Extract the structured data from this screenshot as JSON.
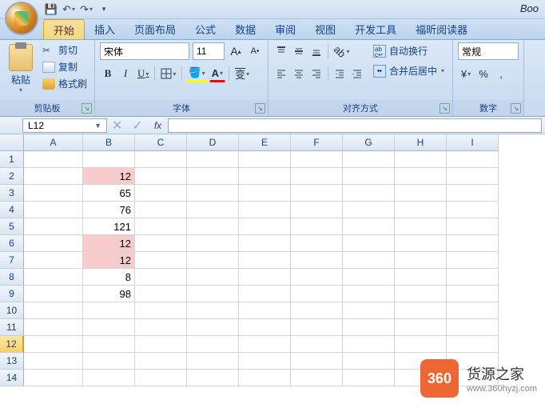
{
  "title": "Boo",
  "qat": {
    "save": "save-icon",
    "undo": "undo-icon",
    "redo": "redo-icon"
  },
  "tabs": [
    "开始",
    "插入",
    "页面布局",
    "公式",
    "数据",
    "审阅",
    "视图",
    "开发工具",
    "福昕阅读器"
  ],
  "active_tab": 0,
  "clipboard": {
    "paste": "粘贴",
    "cut": "剪切",
    "copy": "复制",
    "format_painter": "格式刷",
    "group": "剪贴板"
  },
  "font": {
    "name": "宋体",
    "size": "11",
    "grow": "A",
    "shrink": "A",
    "group": "字体",
    "bold": "B",
    "italic": "I",
    "underline": "U"
  },
  "alignment": {
    "wrap": "自动换行",
    "merge": "合并后居中",
    "group": "对齐方式"
  },
  "number": {
    "format": "常规",
    "group": "数字",
    "percent": "%",
    "comma": ","
  },
  "namebox": "L12",
  "fx": "fx",
  "columns": [
    "A",
    "B",
    "C",
    "D",
    "E",
    "F",
    "G",
    "H",
    "I"
  ],
  "rows": [
    1,
    2,
    3,
    4,
    5,
    6,
    7,
    8,
    9,
    10,
    11,
    12,
    13,
    14
  ],
  "selected_row": 12,
  "chart_data": {
    "type": "table",
    "cells": [
      {
        "r": 2,
        "c": "B",
        "v": 12,
        "highlight": true
      },
      {
        "r": 3,
        "c": "B",
        "v": 65,
        "highlight": false
      },
      {
        "r": 4,
        "c": "B",
        "v": 76,
        "highlight": false
      },
      {
        "r": 5,
        "c": "B",
        "v": 121,
        "highlight": false
      },
      {
        "r": 6,
        "c": "B",
        "v": 12,
        "highlight": true
      },
      {
        "r": 7,
        "c": "B",
        "v": 12,
        "highlight": true
      },
      {
        "r": 8,
        "c": "B",
        "v": 8,
        "highlight": false
      },
      {
        "r": 9,
        "c": "B",
        "v": 98,
        "highlight": false
      }
    ]
  },
  "watermark": {
    "badge": "360",
    "text": "货源之家",
    "url": "www.360hyzj.com"
  }
}
